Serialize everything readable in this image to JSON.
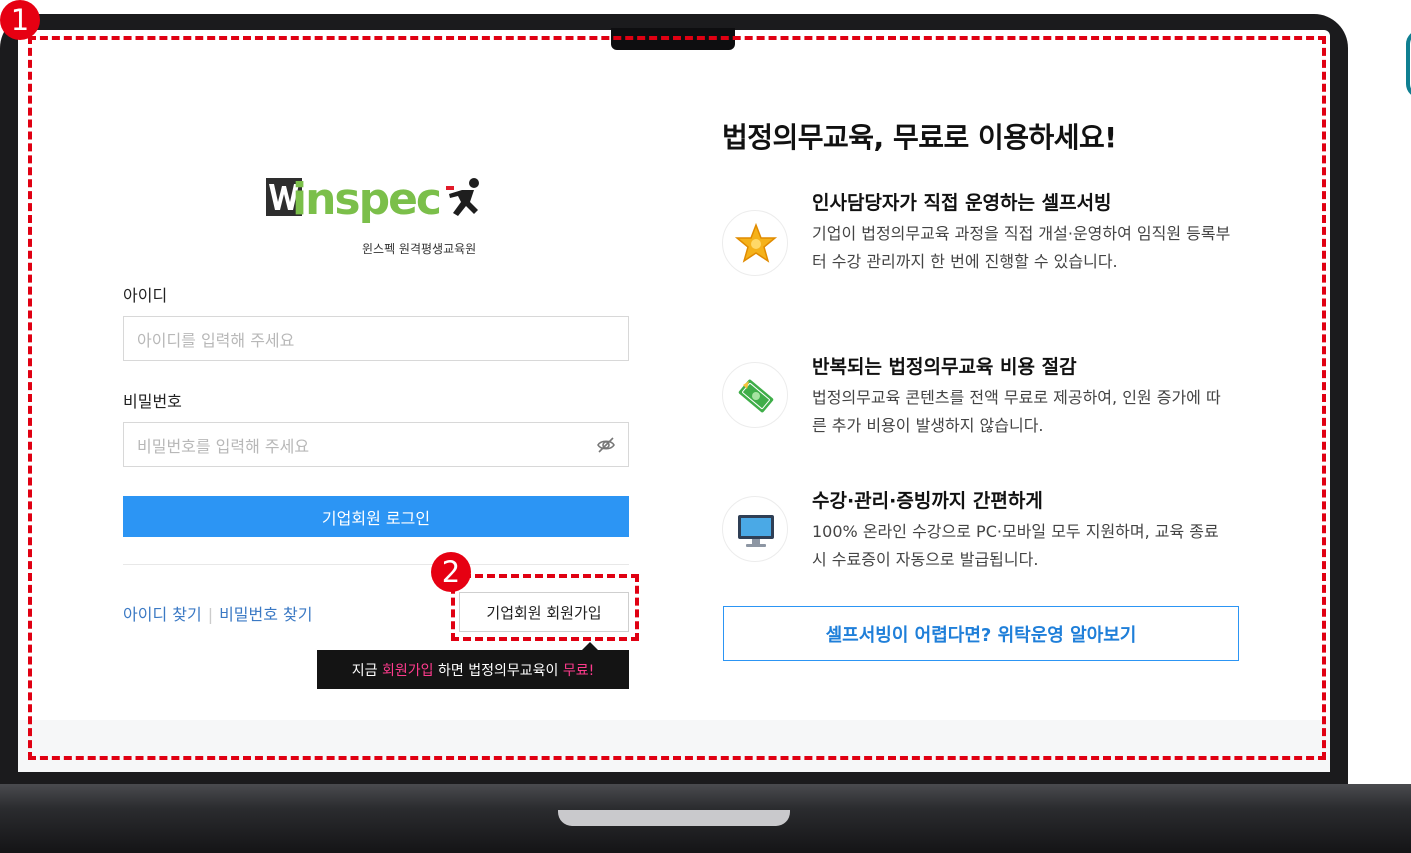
{
  "login": {
    "logo_text": "inspec",
    "logo_subtitle": "윈스펙 원격평생교육원",
    "id_label": "아이디",
    "id_placeholder": "아이디를 입력해 주세요",
    "pw_label": "비밀번호",
    "pw_placeholder": "비밀번호를 입력해 주세요",
    "login_button": "기업회원 로그인",
    "find_id": "아이디 찾기",
    "find_pw": "비밀번호 찾기",
    "separator": "|",
    "signup_button": "기업회원 회원가입",
    "tooltip": {
      "part1": "지금 ",
      "highlight1": "회원가입",
      "part2": " 하면 법정의무교육이 ",
      "highlight2": "무료!"
    }
  },
  "promo": {
    "title": "법정의무교육, 무료로 이용하세요!",
    "features": [
      {
        "title": "인사담당자가 직접 운영하는 셀프서빙",
        "desc": "기업이 법정의무교육 과정을 직접 개설·운영하여 임직원 등록부터 수강 관리까지 한 번에 진행할 수 있습니다.",
        "icon": "star-badge-icon"
      },
      {
        "title": "반복되는 법정의무교육 비용 절감",
        "desc": "법정의무교육 콘텐츠를 전액 무료로 제공하여, 인원 증가에 따른 추가 비용이 발생하지 않습니다.",
        "icon": "money-icon"
      },
      {
        "title": "수강·관리·증빙까지 간편하게",
        "desc": "100% 온라인 수강으로 PC·모바일 모두 지원하며, 교육 종료 시 수료증이 자동으로 발급됩니다.",
        "icon": "monitor-icon"
      }
    ],
    "outline_button": "셀프서빙이 어렵다면? 위탁운영 알아보기"
  },
  "annotations": {
    "badge1": "1",
    "badge2": "2"
  },
  "colors": {
    "primary_blue": "#2c95f4",
    "annotation_red": "#e00012",
    "tooltip_pink": "#ff3b8d",
    "logo_green": "#7bbf4a"
  }
}
